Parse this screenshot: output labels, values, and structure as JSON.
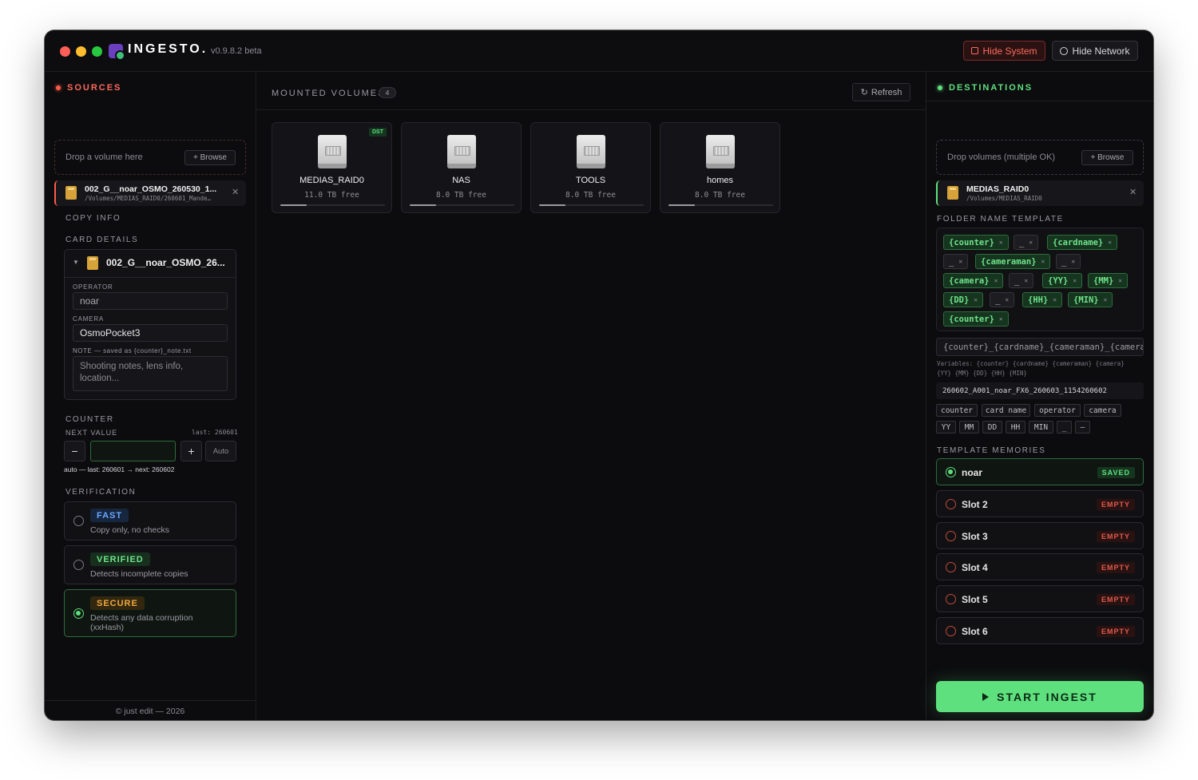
{
  "app": {
    "brand": "INGESTO.",
    "version": "v0.9.8.2 beta",
    "hide_system": "Hide System",
    "hide_network": "Hide Network"
  },
  "sources": {
    "title": "SOURCES",
    "drop_text": "Drop a volume here",
    "browse": "+ Browse",
    "card": {
      "name": "002_G__noar_OSMO_260530_1...",
      "path": "/Volumes/MEDIAS_RAID0/260601_Mande…"
    },
    "copy_info": "COPY INFO",
    "card_details": "CARD DETAILS",
    "detail": {
      "name": "002_G__noar_OSMO_26...",
      "operator_label": "OPERATOR",
      "operator_value": "noar",
      "camera_label": "CAMERA",
      "camera_value": "OsmoPocket3",
      "note_label": "NOTE — saved as {counter}_note.txt",
      "note_placeholder": "Shooting notes, lens info, location..."
    },
    "counter": {
      "title": "COUNTER",
      "next_value": "NEXT VALUE",
      "last": "last: 260601",
      "auto": "Auto",
      "hint": "auto — last: 260601 → next: 260602",
      "minus": "−",
      "plus": "+"
    },
    "verification": {
      "title": "VERIFICATION",
      "options": [
        {
          "tag": "FAST",
          "desc": "Copy only, no checks",
          "selected": false
        },
        {
          "tag": "VERIFIED",
          "desc": "Detects incomplete copies",
          "selected": false
        },
        {
          "tag": "SECURE",
          "desc": "Detects any data corruption (xxHash)",
          "selected": true
        }
      ]
    },
    "footer": "© just edit — 2026"
  },
  "mounted": {
    "title": "MOUNTED VOLUMES",
    "count": "4",
    "refresh": "Refresh",
    "volumes": [
      {
        "name": "MEDIAS_RAID0",
        "free": "11.0 TB free",
        "badge": "DST",
        "usage": 0.25
      },
      {
        "name": "NAS",
        "free": "8.0 TB free",
        "badge": "",
        "usage": 0.25
      },
      {
        "name": "TOOLS",
        "free": "8.0 TB free",
        "badge": "",
        "usage": 0.25
      },
      {
        "name": "homes",
        "free": "8.0 TB free",
        "badge": "",
        "usage": 0.25
      }
    ]
  },
  "destinations": {
    "title": "DESTINATIONS",
    "drop_text": "Drop volumes (multiple OK)",
    "browse": "+ Browse",
    "card": {
      "name": "MEDIAS_RAID0",
      "path": "/Volumes/MEDIAS_RAID0"
    },
    "folder_template_title": "FOLDER NAME TEMPLATE",
    "chips": [
      {
        "label": "{counter}",
        "kind": "g"
      },
      {
        "label": "_",
        "kind": "s"
      },
      {
        "label": "{cardname}",
        "kind": "g"
      },
      {
        "label": "_",
        "kind": "s"
      },
      {
        "label": "{cameraman}",
        "kind": "g"
      },
      {
        "label": "_",
        "kind": "s"
      },
      {
        "label": "{camera}",
        "kind": "g"
      },
      {
        "label": "_",
        "kind": "s"
      },
      {
        "label": "{YY}",
        "kind": "g"
      },
      {
        "label": "{MM}",
        "kind": "g"
      },
      {
        "label": "{DD}",
        "kind": "g"
      },
      {
        "label": "_",
        "kind": "s"
      },
      {
        "label": "{HH}",
        "kind": "g"
      },
      {
        "label": "{MIN}",
        "kind": "g"
      },
      {
        "label": "{counter}",
        "kind": "g"
      }
    ],
    "template_string": "{counter}_{cardname}_{cameraman}_{camera",
    "variables_line1": "Variables: {counter} {cardname} {cameraman} {camera}",
    "variables_line2": "{YY} {MM} {DD} {HH} {MIN}",
    "preview": "260602_A001_noar_FX6_260603_1154260602",
    "var_tags": [
      "counter",
      "card name",
      "operator",
      "camera",
      "YY",
      "MM",
      "DD",
      "HH",
      "MIN",
      "_",
      "–"
    ],
    "memories_title": "TEMPLATE MEMORIES",
    "memories": [
      {
        "name": "noar",
        "status": "SAVED"
      },
      {
        "name": "Slot 2",
        "status": "EMPTY"
      },
      {
        "name": "Slot 3",
        "status": "EMPTY"
      },
      {
        "name": "Slot 4",
        "status": "EMPTY"
      },
      {
        "name": "Slot 5",
        "status": "EMPTY"
      },
      {
        "name": "Slot 6",
        "status": "EMPTY"
      }
    ],
    "start": "START INGEST"
  },
  "colors": {
    "accent_green": "#5fe07e",
    "accent_red": "#ff5a4a",
    "bg": "#0c0c0e"
  }
}
